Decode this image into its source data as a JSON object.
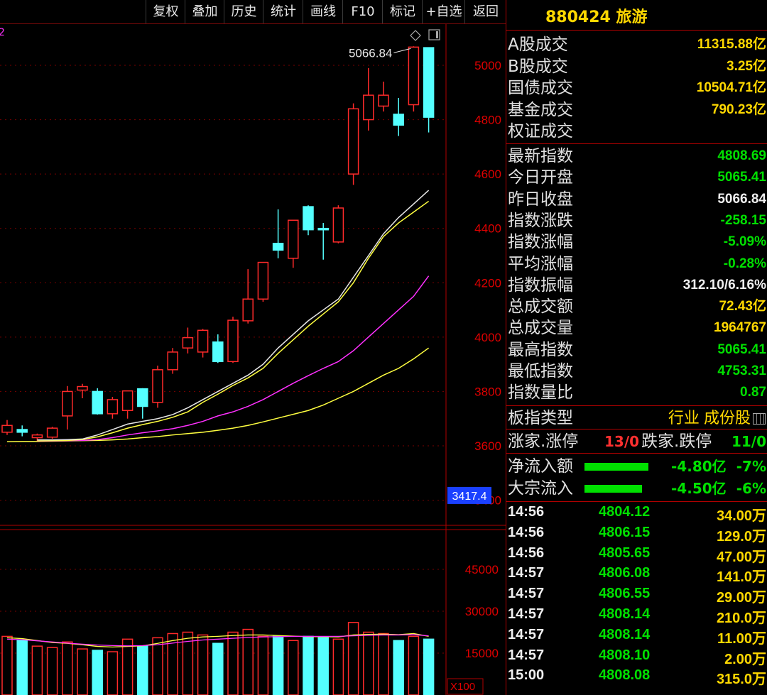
{
  "toolbar": {
    "buttons": [
      "复权",
      "叠加",
      "历史",
      "统计",
      "画线",
      "F10",
      "标记",
      "+自选",
      "返回"
    ]
  },
  "chart": {
    "peak_label": "5066.84",
    "price_ticks": [
      "5000",
      "4800",
      "4600",
      "4400",
      "4200",
      "4000",
      "3800",
      "3600",
      "3400"
    ],
    "current_marker": "3417.4",
    "volume_ticks": [
      "45000",
      "30000",
      "15000"
    ],
    "volume_unit": "X100",
    "colors": {
      "up": "#ff2a2a",
      "down": "#54ffff",
      "ma5": "#e8e8e8",
      "ma10": "#ffff40",
      "ma20": "#ff30ff",
      "ma60": "#ffff40"
    }
  },
  "chart_data": {
    "type": "candlestick",
    "candles": [
      {
        "o": 3650,
        "h": 3695,
        "l": 3640,
        "c": 3675
      },
      {
        "o": 3660,
        "h": 3675,
        "l": 3635,
        "c": 3650
      },
      {
        "o": 3630,
        "h": 3645,
        "l": 3615,
        "c": 3640
      },
      {
        "o": 3632,
        "h": 3670,
        "l": 3626,
        "c": 3665
      },
      {
        "o": 3710,
        "h": 3820,
        "l": 3660,
        "c": 3800
      },
      {
        "o": 3805,
        "h": 3828,
        "l": 3775,
        "c": 3818
      },
      {
        "o": 3800,
        "h": 3812,
        "l": 3715,
        "c": 3718
      },
      {
        "o": 3718,
        "h": 3780,
        "l": 3700,
        "c": 3770
      },
      {
        "o": 3730,
        "h": 3790,
        "l": 3700,
        "c": 3802
      },
      {
        "o": 3810,
        "h": 3812,
        "l": 3700,
        "c": 3745
      },
      {
        "o": 3760,
        "h": 3895,
        "l": 3740,
        "c": 3880
      },
      {
        "o": 3880,
        "h": 3960,
        "l": 3865,
        "c": 3945
      },
      {
        "o": 3960,
        "h": 4035,
        "l": 3940,
        "c": 3998
      },
      {
        "o": 3945,
        "h": 4030,
        "l": 3925,
        "c": 4025
      },
      {
        "o": 3982,
        "h": 4010,
        "l": 3905,
        "c": 3910
      },
      {
        "o": 3910,
        "h": 4075,
        "l": 3905,
        "c": 4062
      },
      {
        "o": 4060,
        "h": 4250,
        "l": 4050,
        "c": 4140
      },
      {
        "o": 4140,
        "h": 4260,
        "l": 4130,
        "c": 4275
      },
      {
        "o": 4345,
        "h": 4470,
        "l": 4290,
        "c": 4320
      },
      {
        "o": 4290,
        "h": 4430,
        "l": 4255,
        "c": 4430
      },
      {
        "o": 4480,
        "h": 4485,
        "l": 4375,
        "c": 4395
      },
      {
        "o": 4400,
        "h": 4420,
        "l": 4285,
        "c": 4395
      },
      {
        "o": 4350,
        "h": 4485,
        "l": 4345,
        "c": 4475
      },
      {
        "o": 4600,
        "h": 4860,
        "l": 4560,
        "c": 4840
      },
      {
        "o": 4800,
        "h": 4990,
        "l": 4760,
        "c": 4890
      },
      {
        "o": 4850,
        "h": 4940,
        "l": 4830,
        "c": 4890
      },
      {
        "o": 4820,
        "h": 4880,
        "l": 4740,
        "c": 4780
      },
      {
        "o": 4855,
        "h": 5070,
        "l": 4830,
        "c": 5067
      },
      {
        "o": 5065,
        "h": 5066,
        "l": 4753,
        "c": 4809
      }
    ],
    "ma": {
      "ma5": [
        3622,
        3622,
        3623,
        3625,
        3640,
        3660,
        3680,
        3690,
        3700,
        3715,
        3740,
        3770,
        3800,
        3830,
        3860,
        3900,
        3960,
        4010,
        4060,
        4100,
        4140,
        4220,
        4300,
        4380,
        4440,
        4490,
        4540
      ],
      "ma10": [
        3618,
        3619,
        3620,
        3623,
        3633,
        3648,
        3665,
        3678,
        3690,
        3705,
        3725,
        3760,
        3790,
        3822,
        3850,
        3885,
        3940,
        3990,
        4040,
        4085,
        4130,
        4200,
        4290,
        4370,
        4420,
        4460,
        4500
      ],
      "ma20": [
        3617,
        3618,
        3619,
        3620,
        3623,
        3630,
        3640,
        3648,
        3655,
        3663,
        3675,
        3690,
        3710,
        3725,
        3745,
        3770,
        3800,
        3830,
        3858,
        3885,
        3910,
        3950,
        4000,
        4050,
        4100,
        4150,
        4225
      ],
      "ma60": [
        3615,
        3616,
        3616,
        3617,
        3618,
        3619,
        3620,
        3622,
        3625,
        3630,
        3634,
        3640,
        3645,
        3650,
        3657,
        3665,
        3675,
        3688,
        3702,
        3716,
        3730,
        3750,
        3775,
        3800,
        3830,
        3860,
        3885,
        3920,
        3960
      ]
    },
    "volumes": [
      21000,
      19500,
      17500,
      17000,
      19000,
      16500,
      16000,
      15500,
      20000,
      17500,
      20500,
      22000,
      22500,
      21500,
      18500,
      22500,
      23500,
      21000,
      21000,
      19500,
      21000,
      20500,
      20000,
      26000,
      22500,
      22000,
      19500,
      21000,
      20000
    ],
    "y_range": [
      3400,
      5100
    ],
    "volume_range": [
      0,
      55000
    ]
  },
  "panel": {
    "title": "880424 旅游",
    "turnover": [
      {
        "label": "A股成交",
        "value": "11315.88亿"
      },
      {
        "label": "B股成交",
        "value": "3.25亿"
      },
      {
        "label": "国债成交",
        "value": "10504.71亿"
      },
      {
        "label": "基金成交",
        "value": "790.23亿"
      },
      {
        "label": "权证成交",
        "value": ""
      }
    ],
    "stats": [
      {
        "label": "最新指数",
        "value": "4808.69",
        "color": "green"
      },
      {
        "label": "今日开盘",
        "value": "5065.41",
        "color": "green"
      },
      {
        "label": "昨日收盘",
        "value": "5066.84",
        "color": "white"
      },
      {
        "label": "指数涨跌",
        "value": "-258.15",
        "color": "green"
      },
      {
        "label": "指数涨幅",
        "value": "-5.09%",
        "color": "green"
      },
      {
        "label": "平均涨幅",
        "value": "-0.28%",
        "color": "green"
      },
      {
        "label": "指数振幅",
        "value": "312.10/6.16%",
        "color": "white"
      },
      {
        "label": "总成交额",
        "value": "72.43亿",
        "color": "yellow"
      },
      {
        "label": "总成交量",
        "value": "1964767",
        "color": "yellow"
      },
      {
        "label": "最高指数",
        "value": "5065.41",
        "color": "green"
      },
      {
        "label": "最低指数",
        "value": "4753.31",
        "color": "green"
      },
      {
        "label": "指数量比",
        "value": "0.87",
        "color": "green"
      }
    ],
    "sector_type_label": "板指类型",
    "sector_type_value": "行业 成份股",
    "updown": {
      "up_label": "涨家.涨停",
      "up_value": "13/0",
      "down_label": "跌家.跌停",
      "down_value": "11/0"
    },
    "flows": [
      {
        "label": "净流入额",
        "value": "-4.80亿",
        "pct": "-7%",
        "bar": 0.8
      },
      {
        "label": "大宗流入",
        "value": "-4.50亿",
        "pct": "-6%",
        "bar": 0.72
      }
    ],
    "ticks": [
      {
        "time": "14:56",
        "price": "4804.12",
        "vol": "34.00万"
      },
      {
        "time": "14:56",
        "price": "4806.15",
        "vol": "129.0万"
      },
      {
        "time": "14:56",
        "price": "4805.65",
        "vol": "47.00万"
      },
      {
        "time": "14:57",
        "price": "4806.08",
        "vol": "141.0万"
      },
      {
        "time": "14:57",
        "price": "4806.55",
        "vol": "29.00万"
      },
      {
        "time": "14:57",
        "price": "4808.14",
        "vol": "210.0万"
      },
      {
        "time": "14:57",
        "price": "4808.14",
        "vol": "11.00万"
      },
      {
        "time": "14:57",
        "price": "4808.10",
        "vol": "2.00万"
      },
      {
        "time": "15:00",
        "price": "4808.08",
        "vol": "315.0万"
      }
    ]
  }
}
